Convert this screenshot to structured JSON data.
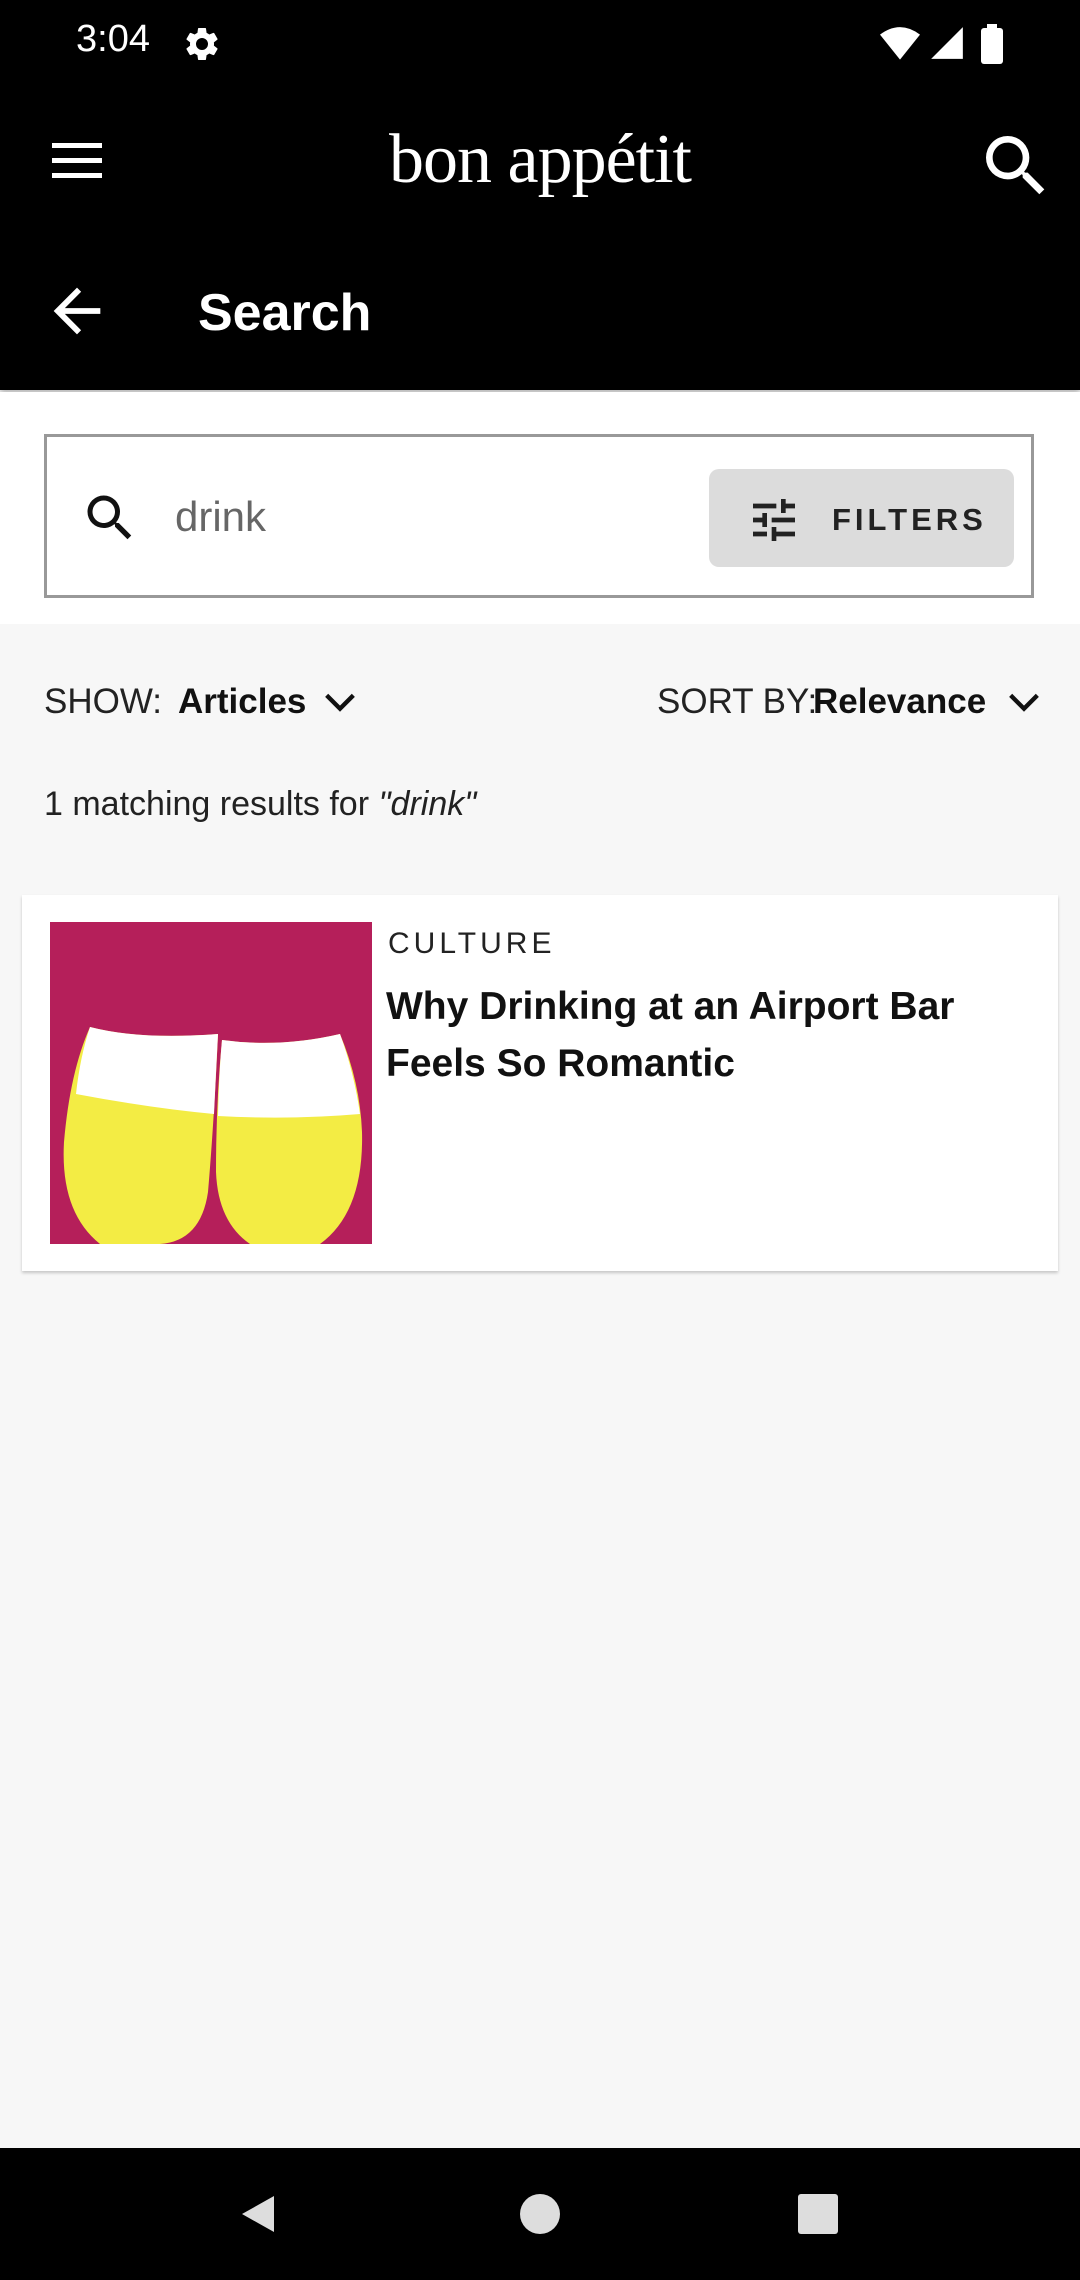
{
  "status_bar": {
    "time": "3:04"
  },
  "header": {
    "brand": "bon appétit",
    "page_title": "Search"
  },
  "search": {
    "query": "drink",
    "filters_label": "FILTERS"
  },
  "controls": {
    "show_label": "SHOW:",
    "show_value": "Articles",
    "sort_label": "SORT BY:",
    "sort_value": "Relevance"
  },
  "results": {
    "count_prefix": "1 matching results for ",
    "count_query": "\"drink\"",
    "items": [
      {
        "category": "CULTURE",
        "title": "Why Drinking at an Airport Bar Feels So Romantic"
      }
    ]
  },
  "colors": {
    "header_bg": "#000000",
    "page_bg": "#f7f7f7",
    "image_bg": "#b51f5a",
    "image_drink": "#f3ec44"
  },
  "icons": [
    "settings-icon",
    "wifi-icon",
    "signal-icon",
    "battery-icon",
    "menu-icon",
    "search-icon",
    "arrow-back-icon",
    "tune-icon",
    "chevron-down-icon",
    "nav-back-icon",
    "nav-home-icon",
    "nav-recents-icon"
  ]
}
